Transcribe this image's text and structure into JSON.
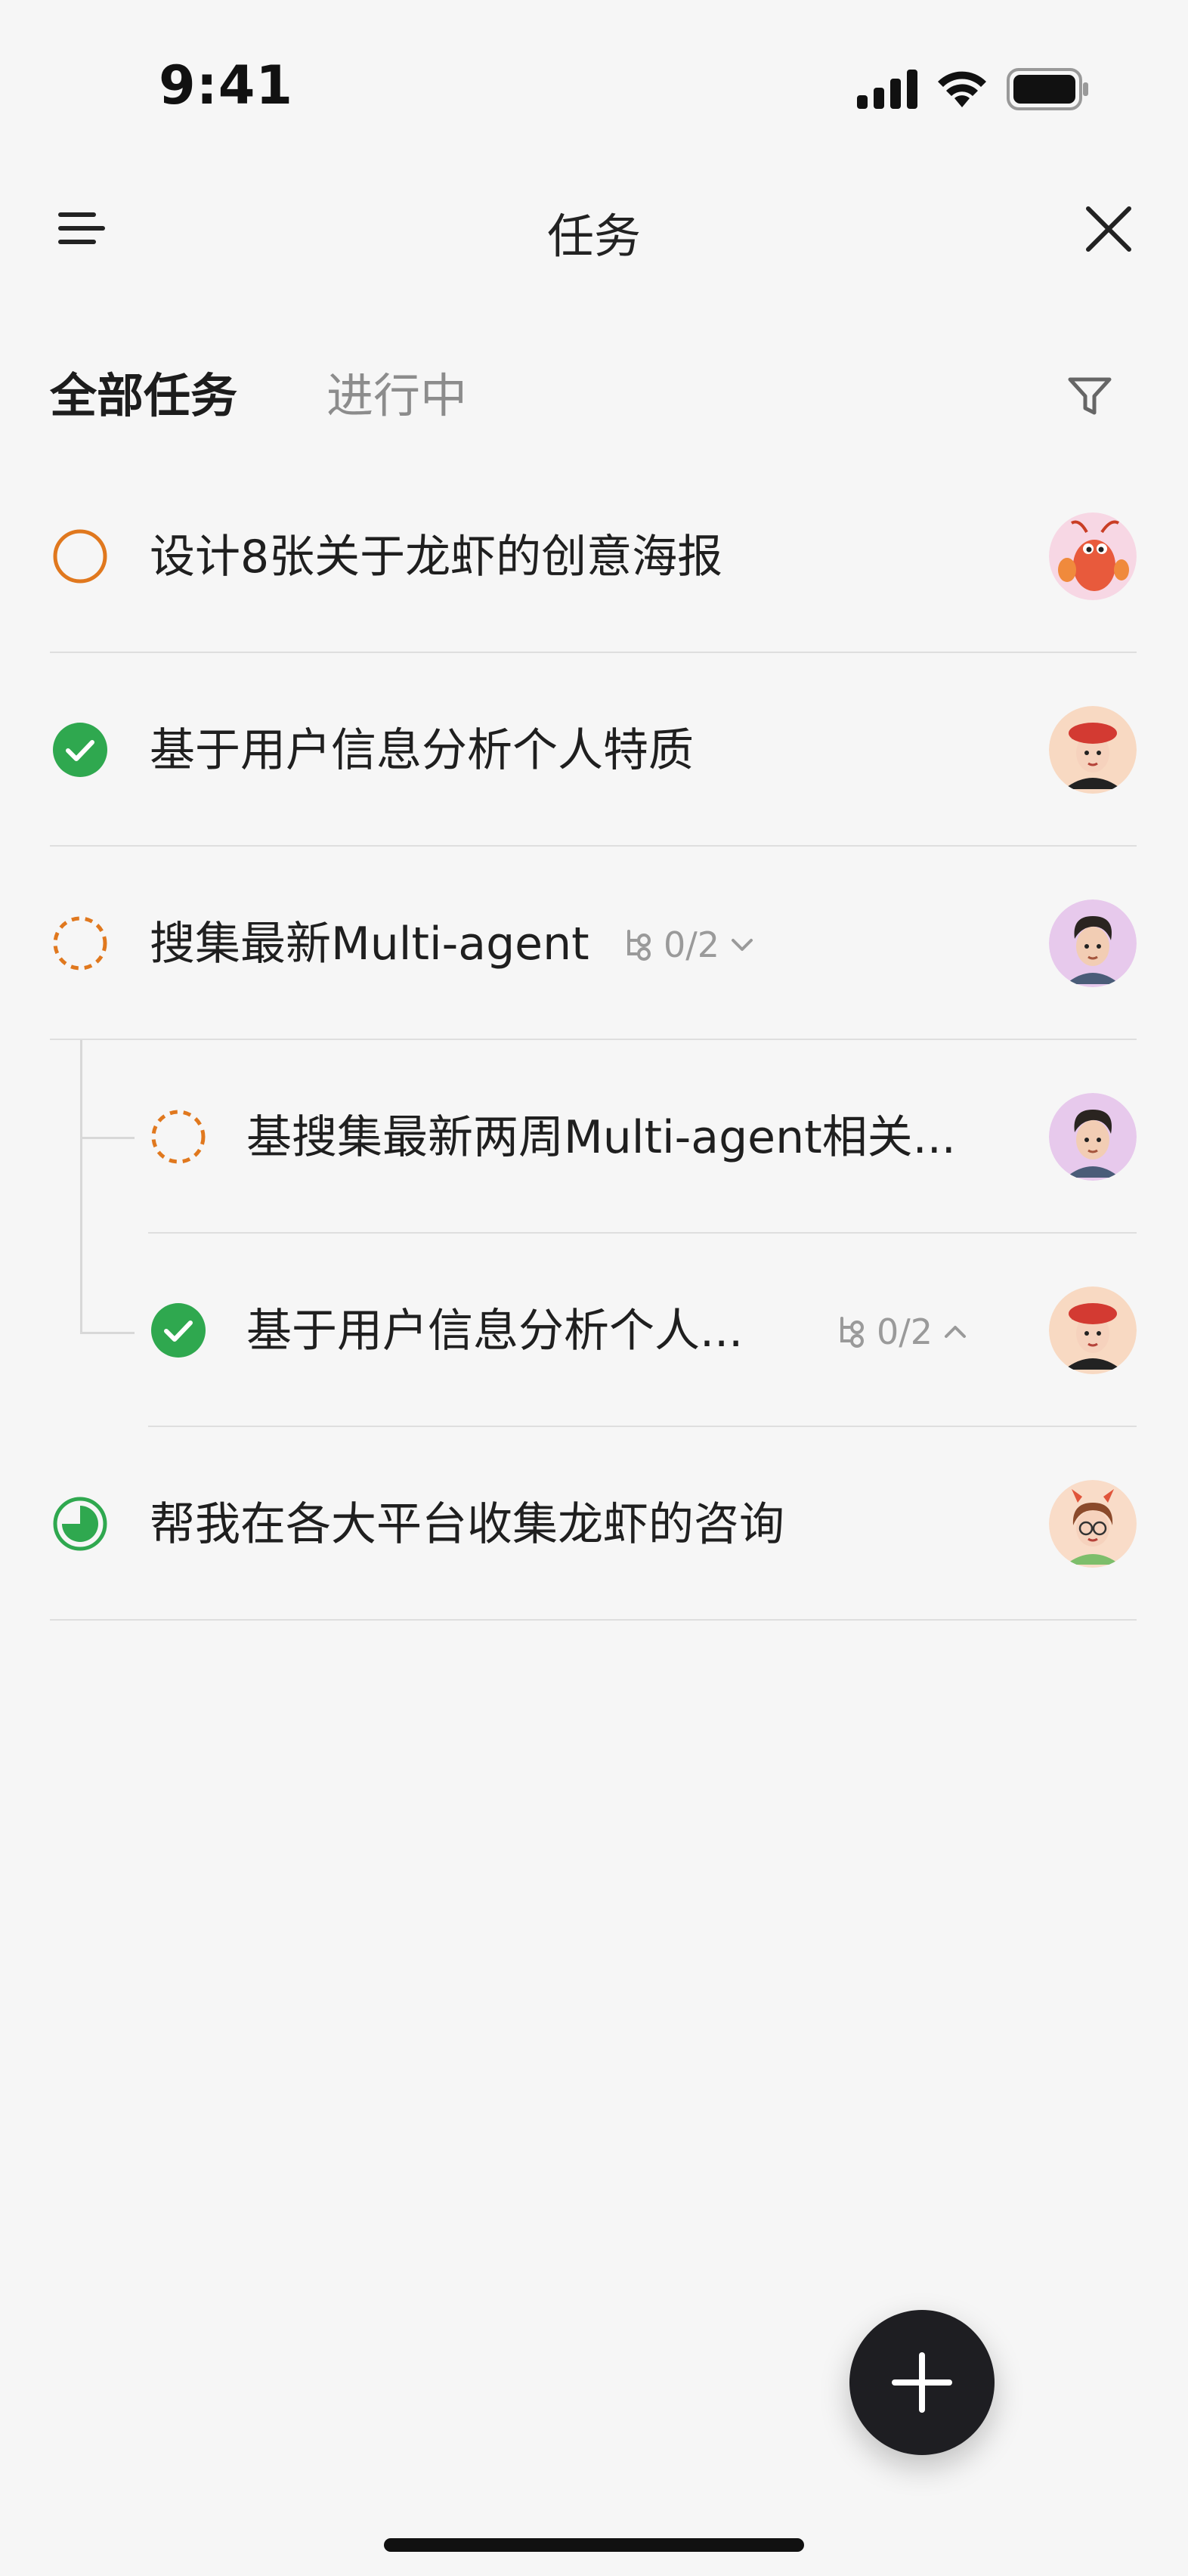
{
  "status_bar": {
    "time": "9:41",
    "icons": [
      "cellular-signal-icon",
      "wifi-icon",
      "battery-icon"
    ]
  },
  "header": {
    "title": "任务",
    "menu_icon": "menu-icon",
    "close_icon": "close-icon"
  },
  "tabs": [
    {
      "label": "全部任务",
      "active": true
    },
    {
      "label": "进行中",
      "active": false
    }
  ],
  "filter_icon": "filter-icon",
  "tasks": [
    {
      "title": "设计8张关于龙虾的创意海报",
      "status": "todo",
      "avatar": "lobster-avatar"
    },
    {
      "title": "基于用户信息分析个人特质",
      "status": "done",
      "avatar": "woman-red-beret-avatar"
    },
    {
      "title": "搜集最新Multi-agent",
      "status": "pending",
      "subtasks": "0/2",
      "expand_icon": "chevron-down-icon",
      "avatar": "man-avatar"
    },
    {
      "title": "基搜集最新两周Multi-agent相关...",
      "status": "pending",
      "avatar": "man-avatar",
      "level": 1
    },
    {
      "title": "基于用户信息分析个人...",
      "status": "done",
      "subtasks": "0/2",
      "expand_icon": "chevron-up-icon",
      "avatar": "woman-red-beret-avatar",
      "level": 1
    },
    {
      "title": "帮我在各大平台收集龙虾的咨询",
      "status": "in-progress",
      "avatar": "girl-glasses-avatar"
    }
  ],
  "colors": {
    "orange": "#E0781E",
    "green": "#2FA84F",
    "fab": "#1E1E22"
  },
  "fab_icon": "plus-icon"
}
